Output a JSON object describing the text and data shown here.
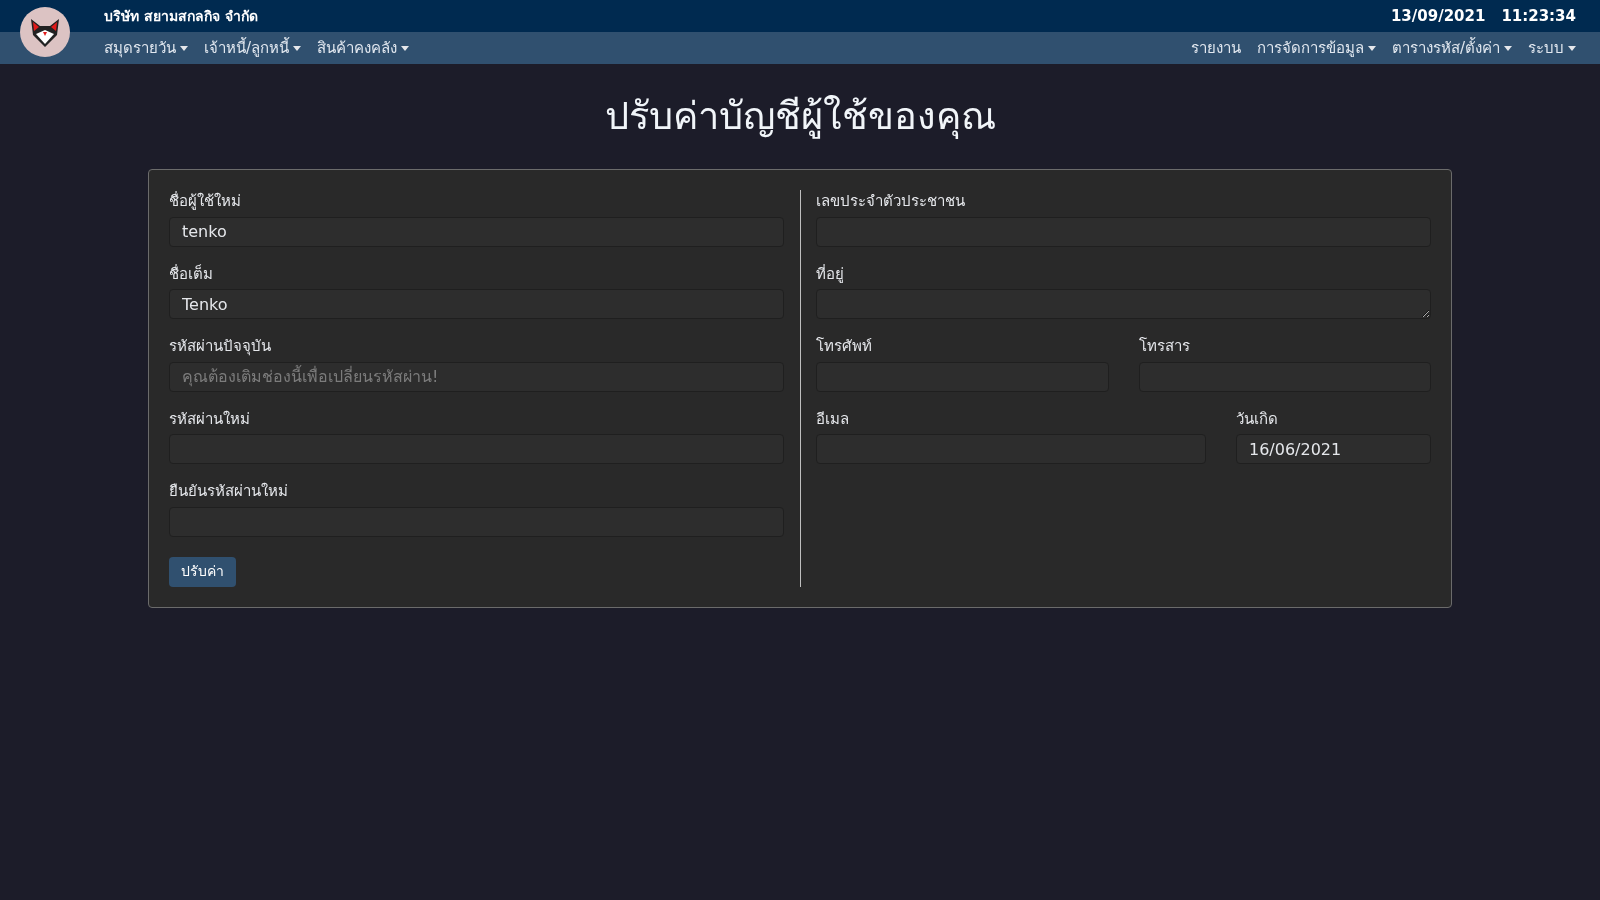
{
  "header": {
    "company": "บริษัท สยามสกลกิจ จำกัด",
    "date": "13/09/2021",
    "time": "11:23:34"
  },
  "menu_left": [
    {
      "label": "สมุดรายวัน",
      "has_caret": true
    },
    {
      "label": "เจ้าหนี้/ลูกหนี้",
      "has_caret": true
    },
    {
      "label": "สินค้าคงคลัง",
      "has_caret": true
    }
  ],
  "menu_right": [
    {
      "label": "รายงาน",
      "has_caret": false
    },
    {
      "label": "การจัดการข้อมูล",
      "has_caret": true
    },
    {
      "label": "ตารางรหัส/ตั้งค่า",
      "has_caret": true
    },
    {
      "label": "ระบบ",
      "has_caret": true
    }
  ],
  "page_title": "ปรับค่าบัญชีผู้ใช้ของคุณ",
  "left_fields": [
    {
      "label": "ชื่อผู้ใช้ใหม่",
      "value": "tenko",
      "kind": "input"
    },
    {
      "label": "ชื่อเต็ม",
      "value": "Tenko",
      "kind": "input"
    },
    {
      "label": "รหัสผ่านปัจจุบัน",
      "placeholder": "คุณต้องเติมช่องนี้เพื่อเปลี่ยนรหัสผ่าน!",
      "kind": "input"
    },
    {
      "label": "รหัสผ่านใหม่",
      "kind": "input"
    },
    {
      "label": "ยืนยันรหัสผ่านใหม่",
      "kind": "input"
    }
  ],
  "right_rows": [
    [
      {
        "label": "เลขประจำตัวประชาชน",
        "kind": "input"
      }
    ],
    [
      {
        "label": "ที่อยู่",
        "kind": "textarea"
      }
    ],
    [
      {
        "label": "โทรศัพท์",
        "kind": "input"
      },
      {
        "label": "โทรสาร",
        "kind": "input"
      }
    ],
    [
      {
        "label": "อีเมล",
        "kind": "input"
      },
      {
        "label": "วันเกิด",
        "value": "16/06/2021",
        "kind": "input"
      }
    ]
  ],
  "submit_button": "ปรับค่า"
}
